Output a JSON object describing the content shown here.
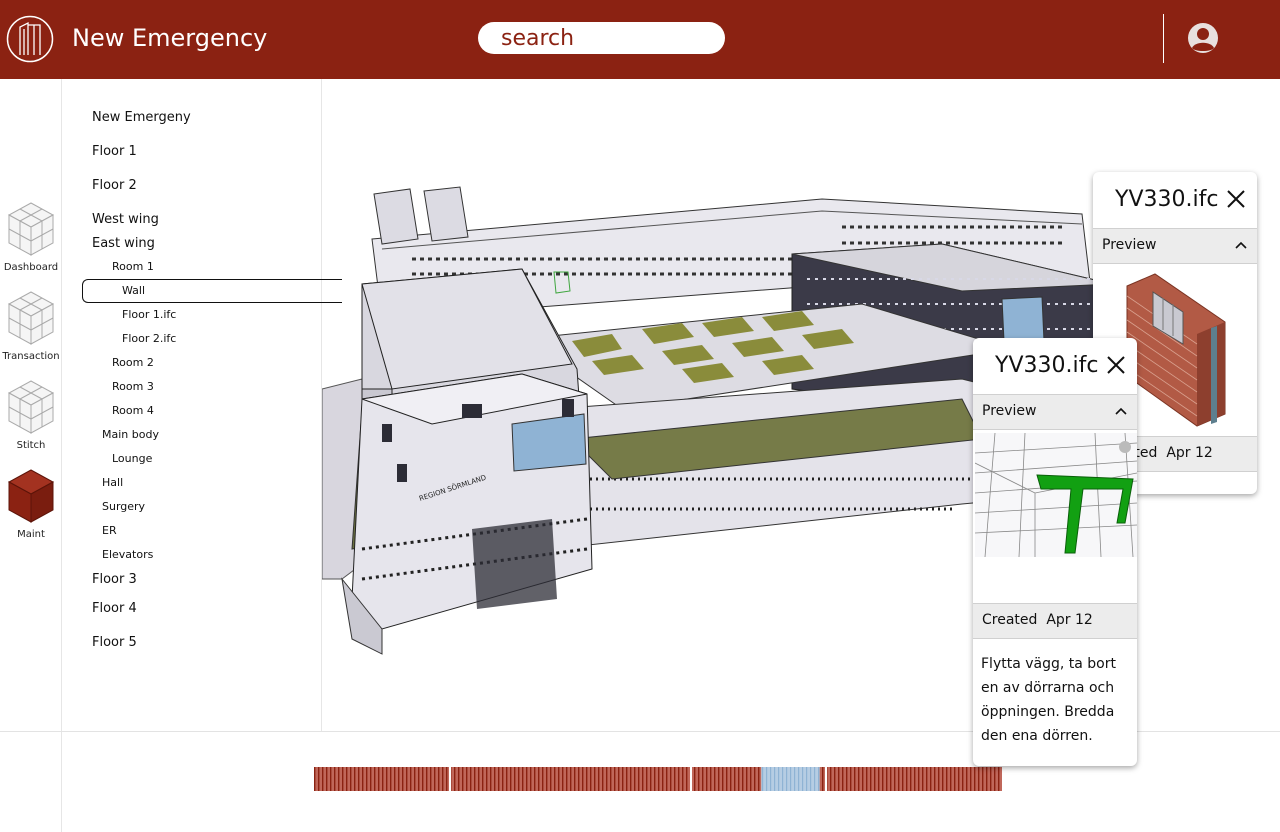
{
  "header": {
    "title": "New Emergency",
    "search_placeholder": "search",
    "search_value": ""
  },
  "colors": {
    "brand": "#8b2212",
    "panel_gray": "#ececec",
    "highlight_blue": "#8fb3d4",
    "preview_green": "#12a012"
  },
  "rail": {
    "items": [
      {
        "label": "Dashboard",
        "icon": "cube-grid-icon",
        "active": false
      },
      {
        "label": "Transaction",
        "icon": "cube-grid-icon",
        "active": false
      },
      {
        "label": "Stitch",
        "icon": "cube-grid-icon",
        "active": false
      },
      {
        "label": "Maint",
        "icon": "cube-grid-icon",
        "active": true
      }
    ]
  },
  "tree": {
    "items": [
      {
        "label": "New Emergeny",
        "level": 0
      },
      {
        "label": "Floor 1",
        "level": 0
      },
      {
        "label": "Floor 2",
        "level": 0
      },
      {
        "label": "West wing",
        "level": 0
      },
      {
        "label": "East wing",
        "level": 0
      },
      {
        "label": "Room 1",
        "level": 2
      },
      {
        "label": "Wall",
        "level": 3,
        "selected": true
      },
      {
        "label": "Floor 1.ifc",
        "level": 3
      },
      {
        "label": "Floor 2.ifc",
        "level": 3
      },
      {
        "label": "Room 2",
        "level": 2
      },
      {
        "label": "Room 3",
        "level": 2
      },
      {
        "label": "Room 4",
        "level": 2
      },
      {
        "label": "Main body",
        "level": 1
      },
      {
        "label": "Lounge",
        "level": 2
      },
      {
        "label": "Hall",
        "level": 1
      },
      {
        "label": "Surgery",
        "level": 1
      },
      {
        "label": "ER",
        "level": 1
      },
      {
        "label": "Elevators",
        "level": 1
      },
      {
        "label": "Floor 3",
        "level": 0
      },
      {
        "label": "Floor 4",
        "level": 0
      },
      {
        "label": "Floor 5",
        "level": 0
      }
    ]
  },
  "cards": {
    "back": {
      "title": "YV330.ifc",
      "section": "Preview",
      "created_label": "Created",
      "created_date": "Apr 12",
      "preview_icon": "brick-wall-icon"
    },
    "front": {
      "title": "YV330.ifc",
      "section": "Preview",
      "created_label": "Created",
      "created_date": "Apr 12",
      "note": "Flytta vägg, ta bort en av dörrarna och öppningen. Bredda den ena dörren.",
      "preview_icon": "wireframe-wall-icon"
    }
  },
  "model": {
    "facade_sign": "REGION SÖRMLAND"
  },
  "timeline": {
    "highlight_start": 0.65,
    "highlight_end": 0.735
  }
}
